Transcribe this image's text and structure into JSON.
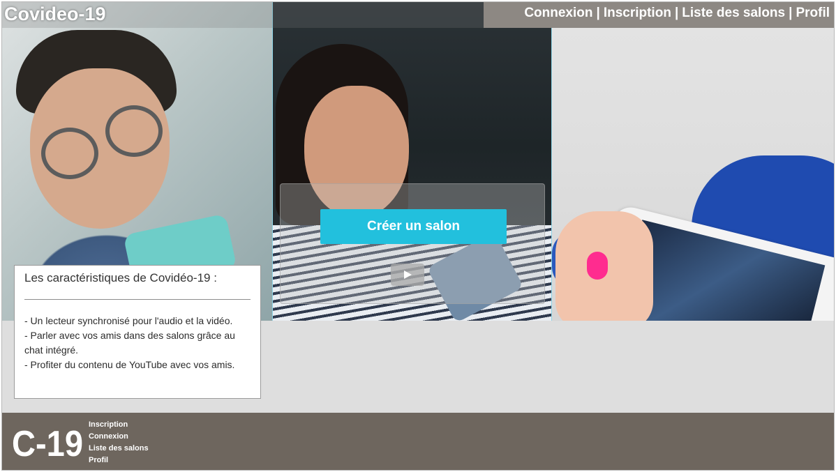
{
  "app": {
    "title": "Covideo-19"
  },
  "nav": {
    "links": [
      "Connexion",
      "Inscription",
      "Liste des salons",
      "Profil"
    ],
    "separator": "|"
  },
  "hero": {
    "create_button_label": "Créer un salon",
    "play_icon": "play-icon"
  },
  "features": {
    "heading": "Les caractéristiques de Covidéo-19 :",
    "items": [
      "- Un lecteur synchronisé pour l'audio et la vidéo.",
      "- Parler avec vos amis dans des salons grâce au chat intégré.",
      "- Profiter du contenu de YouTube avec vos amis."
    ]
  },
  "footer": {
    "logo_text": "C-19",
    "links": [
      "Inscription",
      "Connexion",
      "Liste des salons",
      "Profil"
    ]
  },
  "colors": {
    "accent": "#22c0dd",
    "footer_bg": "#6e665e",
    "nav_bg": "#8d8883"
  }
}
